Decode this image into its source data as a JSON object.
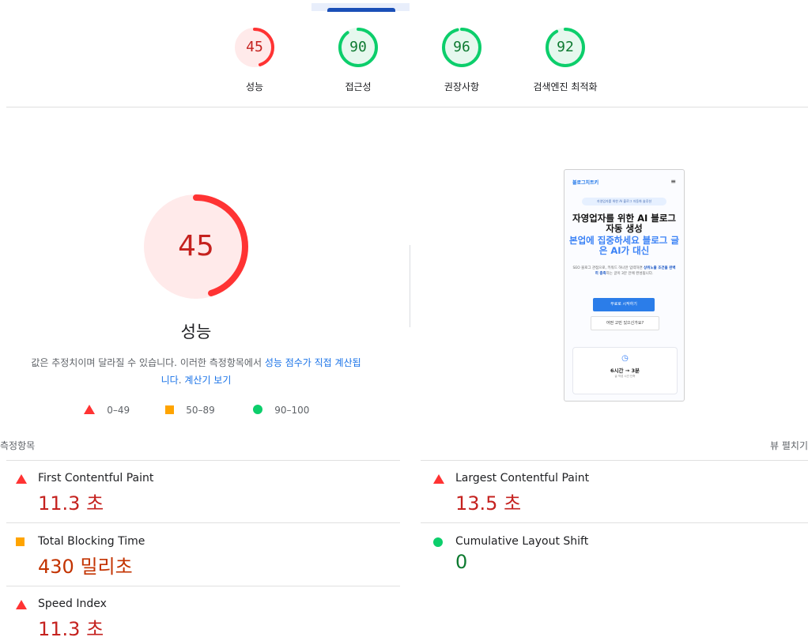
{
  "gauges": [
    {
      "label": "성능",
      "score": 45,
      "status": "fail",
      "color": "#ff3333"
    },
    {
      "label": "접근성",
      "score": 90,
      "status": "pass",
      "color": "#0cce6b"
    },
    {
      "label": "권장사항",
      "score": 96,
      "status": "pass",
      "color": "#0cce6b"
    },
    {
      "label": "검색엔진 최적화",
      "score": 92,
      "status": "pass",
      "color": "#0cce6b"
    }
  ],
  "performance": {
    "score": "45",
    "title": "성능",
    "desc_prefix": "값은 추정치이며 달라질 수 있습니다. 이러한 측정항목에서 ",
    "desc_link1_a": "성능 점수가 직접 계산됩",
    "desc_link1_b": "니다",
    "desc_sep": ". ",
    "desc_link2": "계산기 보기"
  },
  "legend": {
    "fail": "0–49",
    "average": "50–89",
    "pass": "90–100"
  },
  "phone": {
    "brand": "블로그치트키",
    "menu": "≡",
    "pill": "자영업자를 위한 AI 블로그 자동화 솔루션",
    "headline": "자영업자를 위한 AI 블로그 자동 생성",
    "subheadline": "본업에 집중하세요 블로그 글은 AI가 대신",
    "para": "SEO 블로그 관점으로, 키워드 하나만 입력하면",
    "para_bold": "상위노출 조건을 완벽히 충족",
    "para_end": "하는 글이 3분 안에 완성됩니다.",
    "cta": "무료로 시작하기",
    "cta2": "어떤 고민 있으신가요?",
    "card_title": "6시간 → 3분",
    "card_sub": "글 작성 시간 단축"
  },
  "metrics": {
    "header": "측정항목",
    "toggle": "뷰 펼치기",
    "items": [
      {
        "title": "First Contentful Paint",
        "value": "11.3 초",
        "status": "fail"
      },
      {
        "title": "Largest Contentful Paint",
        "value": "13.5 초",
        "status": "fail"
      },
      {
        "title": "Total Blocking Time",
        "value": "430 밀리초",
        "status": "average"
      },
      {
        "title": "Cumulative Layout Shift",
        "value": "0",
        "status": "pass"
      },
      {
        "title": "Speed Index",
        "value": "11.3 초",
        "status": "fail"
      }
    ]
  }
}
